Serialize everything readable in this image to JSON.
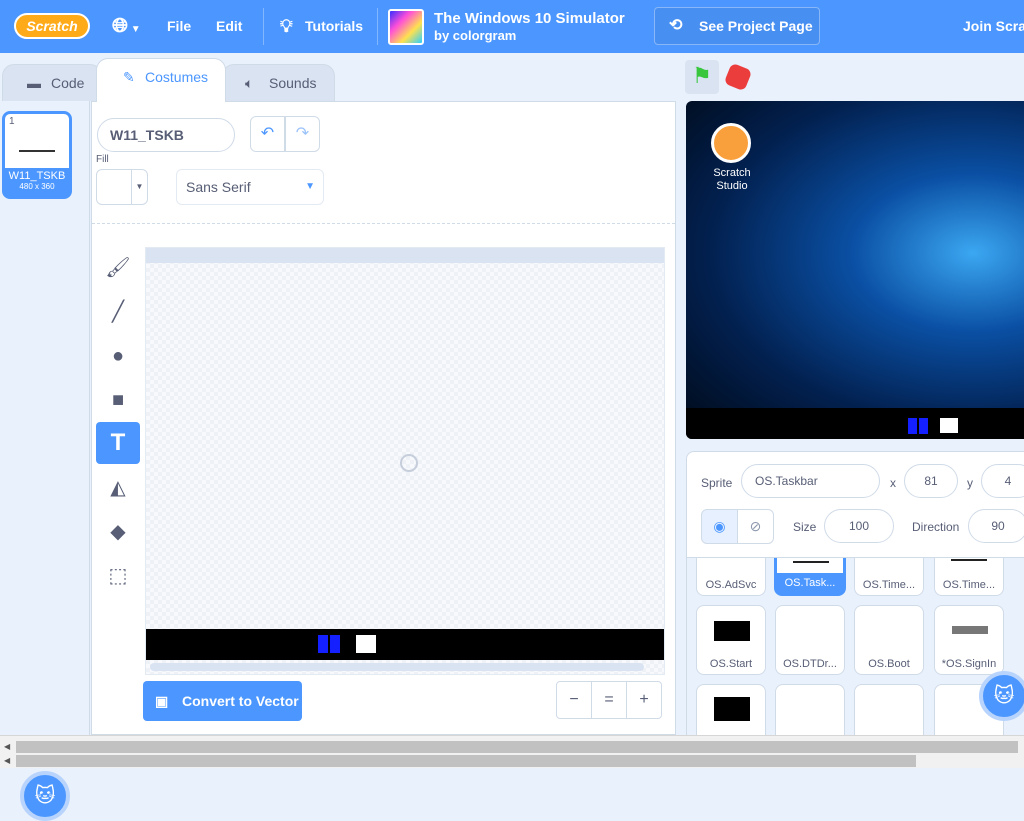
{
  "menubar": {
    "logo": "Scratch",
    "file": "File",
    "edit": "Edit",
    "tutorials": "Tutorials",
    "project_title": "The Windows 10 Simulator",
    "project_author": "by colorgram",
    "see_project": "See Project Page",
    "join": "Join Scra"
  },
  "tabs": {
    "code": "Code",
    "costumes": "Costumes",
    "sounds": "Sounds"
  },
  "costume_list": [
    {
      "number": "1",
      "name": "W11_TSKB",
      "size": "480 x 360"
    }
  ],
  "editor": {
    "costume_name": "W11_TSKB",
    "fill_label": "Fill",
    "font": "Sans Serif",
    "convert_label": "Convert to Vector",
    "zoom_out": "−",
    "zoom_reset": "=",
    "zoom_in": "+"
  },
  "stage": {
    "desktop_icon_label": "Scratch Studio"
  },
  "sprite_info": {
    "sprite_label": "Sprite",
    "sprite_name": "OS.Taskbar",
    "x_label": "x",
    "x_value": "81",
    "y_label": "y",
    "y_value": "4",
    "size_label": "Size",
    "size_value": "100",
    "direction_label": "Direction",
    "direction_value": "90"
  },
  "sprites_row1": [
    "OS.AdSvc",
    "OS.Task...",
    "OS.Time...",
    "OS.Time..."
  ],
  "sprites_row2": [
    "OS.Start",
    "OS.DTDr...",
    "OS.Boot",
    "*OS.SignIn"
  ],
  "colors": {
    "accent": "#4c97ff",
    "menubar": "#4c97ff",
    "stop": "#ec3d3d",
    "flag": "#37c63c"
  }
}
